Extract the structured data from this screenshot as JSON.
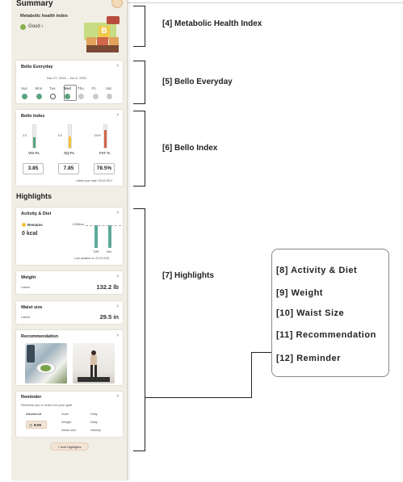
{
  "summary": {
    "title": "Summary",
    "metabolic_label": "Metabolic health index",
    "metabolic_status": "Good",
    "block_letter": "B"
  },
  "everyday": {
    "title": "Bello Everyday",
    "date_range": "Dec 27, 2020 – Jan 2, 2021",
    "days": [
      "Sun",
      "Mon",
      "Tue",
      "Wed",
      "Thu",
      "Fri",
      "Sat"
    ],
    "status": [
      "done",
      "done",
      "empty",
      "done",
      "grey",
      "grey",
      "grey"
    ]
  },
  "bello_index": {
    "title": "Bello Index",
    "metrics": [
      {
        "label": "VIS-FL",
        "value": "3.85",
        "level": 0.45,
        "color": "#5aa37c",
        "ref": "4.5"
      },
      {
        "label": "SQ-FL",
        "value": "7.85",
        "level": 0.5,
        "color": "#f0c33c",
        "ref": "6.5"
      },
      {
        "label": "FAT %",
        "value": "78.5%",
        "level": 0.78,
        "color": "#d1664a",
        "ref": "100%"
      }
    ],
    "scan_date": "Latest scan date: 03.02.2021"
  },
  "highlights": {
    "title": "Highlights",
    "activity": {
      "title": "Activity & Diet",
      "remains_label": "Remains",
      "value": "0 kcal",
      "axis_label": "1,998kcal",
      "bars": [
        {
          "name": "TMR",
          "value": 1.0
        },
        {
          "name": "Diet",
          "value": 1.0
        }
      ],
      "updated": "Last updated on 23.02.2021"
    },
    "weight": {
      "title": "Weight",
      "sub": "Latest",
      "value": "132.2 lb"
    },
    "waist": {
      "title": "Waist size",
      "sub": "Latest",
      "value": "29.5 in"
    },
    "recommendation": {
      "title": "Recommendation"
    },
    "reminder": {
      "title": "Reminder",
      "sub": "Reminds you to reach out your goal",
      "level": "Advanced",
      "time": "9:00",
      "rows": [
        {
          "name": "Scan",
          "freq": "Daily"
        },
        {
          "name": "Weight",
          "freq": "Daily"
        },
        {
          "name": "Waist size",
          "freq": "Weekly"
        }
      ]
    },
    "add_button": "+ Add Highlights"
  },
  "annotations": {
    "a4": "[4]  Metabolic Health Index",
    "a5": "[5]  Bello Everyday",
    "a6": "[6]  Bello Index",
    "a7": "[7] Highlights",
    "list": [
      "[8]  Activity & Diet",
      "[9]  Weight",
      "[10]  Waist Size",
      "[11] Recommendation",
      "[12] Reminder"
    ]
  },
  "colors": {
    "accent_green": "#5aa37c",
    "panel_bg": "#f1eee5",
    "teal_bar": "#5fa99a"
  }
}
